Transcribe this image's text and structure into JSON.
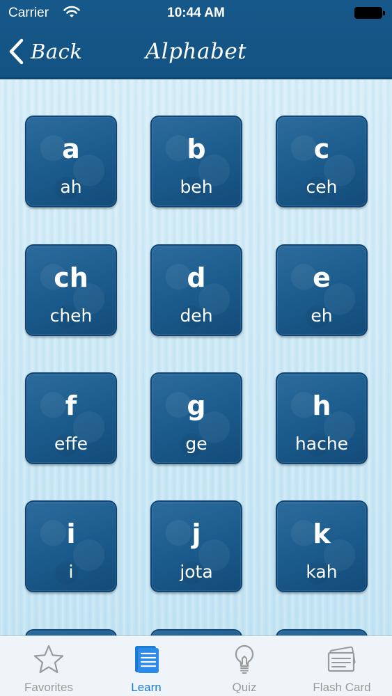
{
  "status_bar": {
    "carrier": "Carrier",
    "time": "10:44 AM"
  },
  "nav": {
    "back_label": "Back",
    "title": "Alphabet"
  },
  "tiles": [
    {
      "letter": "a",
      "sound": "ah"
    },
    {
      "letter": "b",
      "sound": "beh"
    },
    {
      "letter": "c",
      "sound": "ceh"
    },
    {
      "letter": "ch",
      "sound": "cheh"
    },
    {
      "letter": "d",
      "sound": "deh"
    },
    {
      "letter": "e",
      "sound": "eh"
    },
    {
      "letter": "f",
      "sound": "effe"
    },
    {
      "letter": "g",
      "sound": "ge"
    },
    {
      "letter": "h",
      "sound": "hache"
    },
    {
      "letter": "i",
      "sound": "i"
    },
    {
      "letter": "j",
      "sound": "jota"
    },
    {
      "letter": "k",
      "sound": "kah"
    }
  ],
  "tabbar": {
    "active": "learn",
    "tabs": [
      {
        "id": "favorites",
        "label": "Favorites",
        "icon": "star-icon"
      },
      {
        "id": "learn",
        "label": "Learn",
        "icon": "document-icon"
      },
      {
        "id": "quiz",
        "label": "Quiz",
        "icon": "lightbulb-icon"
      },
      {
        "id": "flash-card",
        "label": "Flash Card",
        "icon": "flash-card-icon"
      }
    ]
  },
  "colors": {
    "nav_background": "#17588a",
    "tile_background": "#1a5a8b",
    "content_background": "#cfe9f5",
    "tab_active": "#1b7ad2",
    "tab_inactive": "#9a9a9a"
  }
}
